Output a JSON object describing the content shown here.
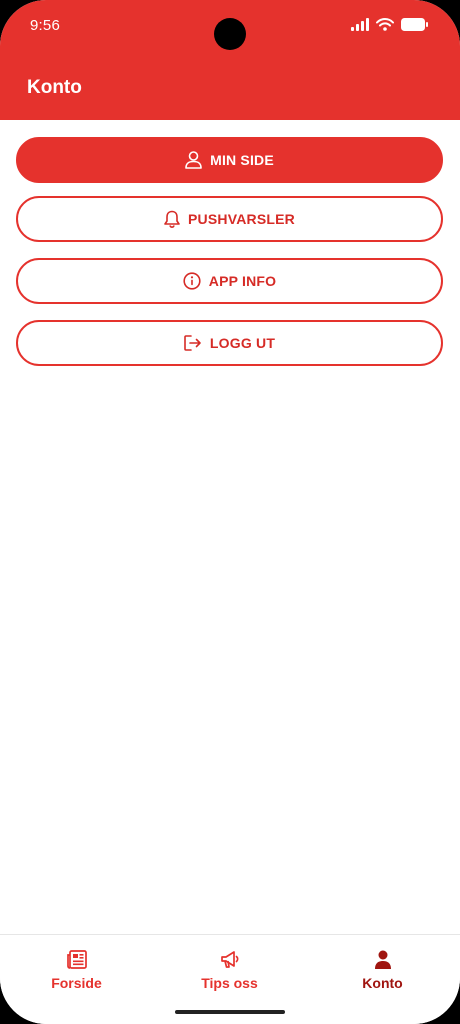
{
  "status_bar": {
    "time": "9:56"
  },
  "header": {
    "title": "Konto"
  },
  "menu": {
    "items": [
      {
        "label": "MIN SIDE",
        "icon": "user-icon",
        "primary": true
      },
      {
        "label": "PUSHVARSLER",
        "icon": "bell-icon",
        "primary": false
      },
      {
        "label": "APP INFO",
        "icon": "info-icon",
        "primary": false
      },
      {
        "label": "LOGG UT",
        "icon": "logout-icon",
        "primary": false
      }
    ]
  },
  "tabbar": {
    "tabs": [
      {
        "label": "Forside",
        "icon": "newspaper-icon",
        "active": false
      },
      {
        "label": "Tips oss",
        "icon": "megaphone-icon",
        "active": false
      },
      {
        "label": "Konto",
        "icon": "person-icon",
        "active": true
      }
    ]
  },
  "colors": {
    "brand": "#e5322d",
    "active_tab": "#a01510"
  }
}
